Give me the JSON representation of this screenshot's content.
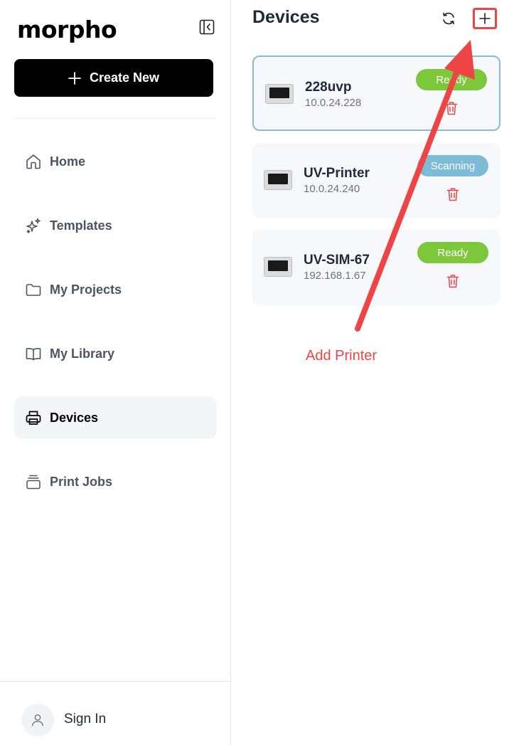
{
  "app": {
    "logo_text": "morpho"
  },
  "sidebar": {
    "create_label": "Create New",
    "items": [
      {
        "label": "Home",
        "icon": "home-icon"
      },
      {
        "label": "Templates",
        "icon": "sparkles-icon"
      },
      {
        "label": "My Projects",
        "icon": "folder-icon"
      },
      {
        "label": "My Library",
        "icon": "book-icon"
      },
      {
        "label": "Devices",
        "icon": "printer-icon",
        "active": true
      },
      {
        "label": "Print Jobs",
        "icon": "stack-icon"
      }
    ],
    "signin_label": "Sign In"
  },
  "main": {
    "title": "Devices",
    "devices": [
      {
        "name": "228uvp",
        "ip": "10.0.24.228",
        "status": "Ready",
        "status_color": "#7cc83a",
        "selected": true
      },
      {
        "name": "UV-Printer",
        "ip": "10.0.24.240",
        "status": "Scanning",
        "status_color": "#7dbbd6"
      },
      {
        "name": "UV-SIM-67",
        "ip": "192.168.1.67",
        "status": "Ready",
        "status_color": "#7cc83a"
      }
    ]
  },
  "annotation": {
    "label": "Add Printer",
    "color": "#ef4444"
  },
  "colors": {
    "accent": "#000000",
    "danger": "#ef4444",
    "active_nav_bg": "#f3f5f9"
  }
}
